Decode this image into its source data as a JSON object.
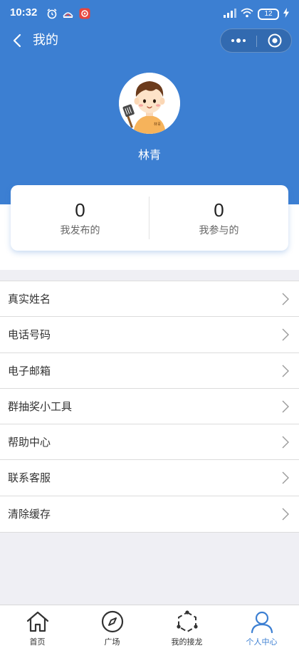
{
  "status_bar": {
    "time": "10:32",
    "battery": "12",
    "notification_icons": [
      "alarm-icon",
      "cast-icon",
      "app-badge-icon"
    ],
    "system_icons": [
      "signal-icon",
      "wifi-icon",
      "battery-icon"
    ]
  },
  "nav": {
    "title": "我的",
    "back_icon": "chevron-left-icon",
    "capsule": [
      "more-dots-icon",
      "close-target-icon"
    ]
  },
  "profile": {
    "name": "林青",
    "avatar_icon": "cartoon-boy-avatar",
    "avatar_shirt_text": "林青"
  },
  "stats": [
    {
      "count": "0",
      "label": "我发布的"
    },
    {
      "count": "0",
      "label": "我参与的"
    }
  ],
  "menu": [
    {
      "label": "真实姓名"
    },
    {
      "label": "电话号码"
    },
    {
      "label": "电子邮箱"
    },
    {
      "label": "群抽奖小工具"
    },
    {
      "label": "帮助中心"
    },
    {
      "label": "联系客服"
    },
    {
      "label": "清除缓存"
    }
  ],
  "tabs": [
    {
      "label": "首页",
      "icon": "home-icon",
      "active": false
    },
    {
      "label": "广场",
      "icon": "compass-icon",
      "active": false
    },
    {
      "label": "我的接龙",
      "icon": "hexagon-nodes-icon",
      "active": false
    },
    {
      "label": "个人中心",
      "icon": "user-icon",
      "active": true
    }
  ],
  "colors": {
    "header_blue": "#3c7fd2",
    "active_tab": "#3c7fd2",
    "page_bg": "#efeff4"
  }
}
